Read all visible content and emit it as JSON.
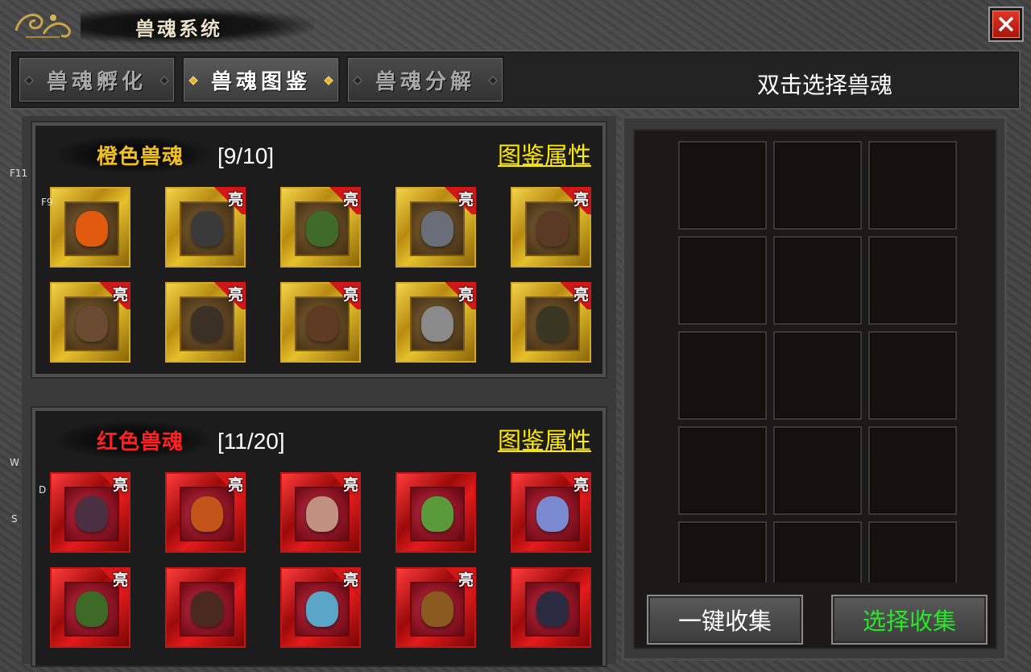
{
  "window": {
    "title": "兽魂系统",
    "close_label": "✕"
  },
  "tabs": [
    {
      "label": "兽魂孵化",
      "active": false
    },
    {
      "label": "兽魂图鉴",
      "active": true
    },
    {
      "label": "兽魂分解",
      "active": false
    }
  ],
  "hint": "双击选择兽魂",
  "sections": [
    {
      "name": "橙色兽魂",
      "name_color": "#f0c020",
      "count": "[9/10]",
      "link": "图鉴属性",
      "cards": [
        {
          "badge": ""
        },
        {
          "badge": "亮"
        },
        {
          "badge": "亮"
        },
        {
          "badge": "亮"
        },
        {
          "badge": "亮"
        },
        {
          "badge": "亮"
        },
        {
          "badge": "亮"
        },
        {
          "badge": "亮"
        },
        {
          "badge": "亮"
        },
        {
          "badge": "亮"
        }
      ]
    },
    {
      "name": "红色兽魂",
      "name_color": "#ff2020",
      "count": "[11/20]",
      "link": "图鉴属性",
      "cards": [
        {
          "badge": "亮"
        },
        {
          "badge": "亮"
        },
        {
          "badge": "亮"
        },
        {
          "badge": ""
        },
        {
          "badge": "亮"
        },
        {
          "badge": "亮"
        },
        {
          "badge": ""
        },
        {
          "badge": "亮"
        },
        {
          "badge": "亮"
        },
        {
          "badge": ""
        }
      ]
    }
  ],
  "slots_count": 15,
  "buttons": {
    "collect_all": "一键收集",
    "collect_selected": "选择收集"
  },
  "side_keys": {
    "f11": "F11",
    "f9": "F9",
    "w": "W",
    "d": "D",
    "s": "S"
  }
}
